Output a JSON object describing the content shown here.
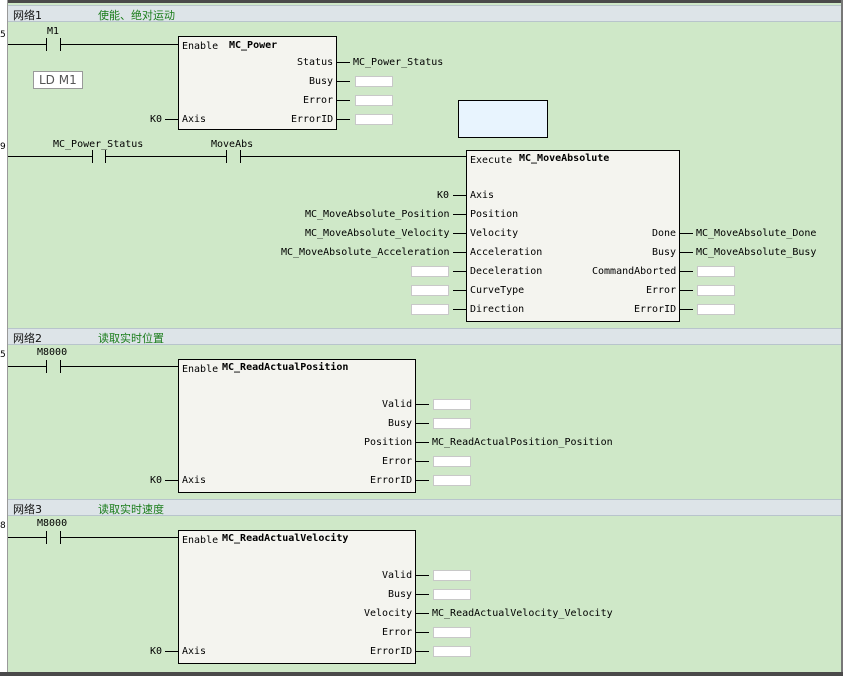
{
  "networks": [
    {
      "name": "网络1",
      "comment": "使能、绝对运动"
    },
    {
      "name": "网络2",
      "comment": "读取实时位置"
    },
    {
      "name": "网络3",
      "comment": "读取实时速度"
    }
  ],
  "rail_numbers": [
    "5",
    "9",
    "5",
    "8"
  ],
  "editor_label": "LD M1",
  "net1": {
    "contact_m1": "M1",
    "contact_power_status": "MC_Power_Status",
    "contact_moveabs": "MoveAbs",
    "power_block": {
      "title": "MC_Power",
      "enable": "Enable",
      "axis": "Axis",
      "axis_var": "K0",
      "outputs": [
        "Status",
        "Busy",
        "Error",
        "ErrorID"
      ],
      "status_var": "MC_Power_Status"
    },
    "moveabs_block": {
      "title": "MC_MoveAbsolute",
      "execute": "Execute",
      "inputs": [
        "Axis",
        "Position",
        "Velocity",
        "Acceleration",
        "Deceleration",
        "CurveType",
        "Direction"
      ],
      "input_vars": [
        "K0",
        "MC_MoveAbsolute_Position",
        "MC_MoveAbsolute_Velocity",
        "MC_MoveAbsolute_Acceleration"
      ],
      "outputs": [
        "Done",
        "Busy",
        "CommandAborted",
        "Error",
        "ErrorID"
      ],
      "output_vars": [
        "MC_MoveAbsolute_Done",
        "MC_MoveAbsolute_Busy"
      ]
    }
  },
  "net2": {
    "contact": "M8000",
    "block": {
      "title": "MC_ReadActualPosition",
      "enable": "Enable",
      "axis": "Axis",
      "axis_var": "K0",
      "outputs": [
        "Valid",
        "Busy",
        "Position",
        "Error",
        "ErrorID"
      ],
      "position_var": "MC_ReadActualPosition_Position"
    }
  },
  "net3": {
    "contact": "M8000",
    "block": {
      "title": "MC_ReadActualVelocity",
      "enable": "Enable",
      "axis": "Axis",
      "axis_var": "K0",
      "outputs": [
        "Valid",
        "Busy",
        "Velocity",
        "Error",
        "ErrorID"
      ],
      "velocity_var": "MC_ReadActualVelocity_Velocity"
    }
  },
  "colors": {
    "background": "#cfe8c8",
    "header": "#dde4e8",
    "comment": "#1a7d1a",
    "block": "#f4f4ef"
  }
}
